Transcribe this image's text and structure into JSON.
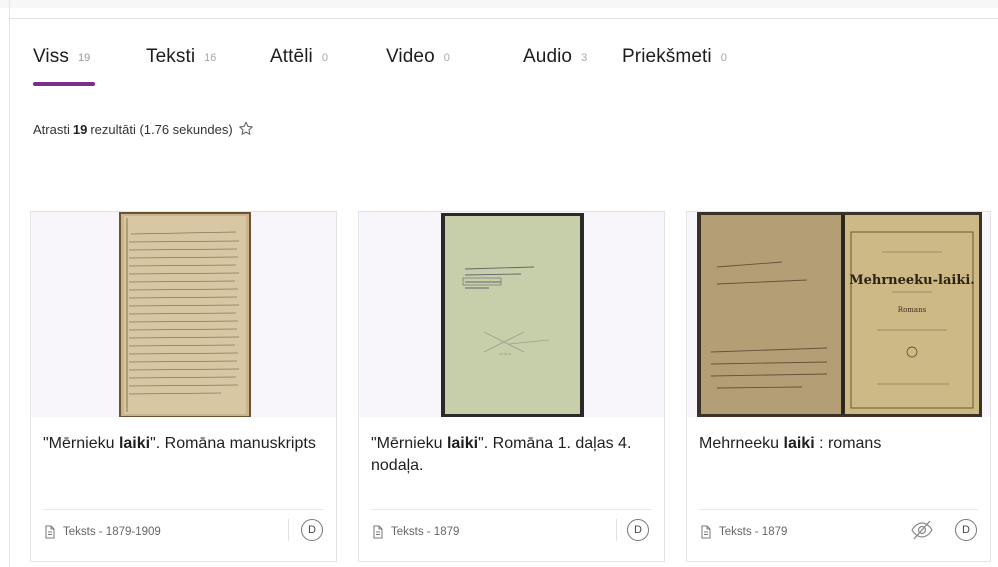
{
  "tabs": [
    {
      "label": "Viss",
      "count": "19",
      "active": true
    },
    {
      "label": "Teksti",
      "count": "16"
    },
    {
      "label": "Attēli",
      "count": "0"
    },
    {
      "label": "Video",
      "count": "0"
    },
    {
      "label": "Audio",
      "count": "3"
    },
    {
      "label": "Priekšmeti",
      "count": "0"
    }
  ],
  "results": {
    "prefix": "Atrasti",
    "count": "19",
    "suffix": "rezultāti (1.76 sekundes)",
    "icon": "star-outline-icon"
  },
  "cards": [
    {
      "title_pre": "\"Mērnieku ",
      "title_bold": "laiki",
      "title_post": "\". Romāna manuskripts",
      "meta": "Teksts - 1879-1909",
      "badge": "D"
    },
    {
      "title_pre": "\"Mērnieku ",
      "title_bold": "laiki",
      "title_post": "\". Romāna 1. daļas 4. nodaļa.",
      "meta": "Teksts - 1879",
      "badge": "D"
    },
    {
      "title_pre": "Mehrneeku ",
      "title_bold": "laiki",
      "title_post": " : romans",
      "meta": "Teksts - 1879",
      "badge": "D",
      "extra_icon": "eye-off-icon",
      "book_title": "Mehrneeku-laiki.",
      "book_subtitle": "Romans"
    }
  ],
  "colors": {
    "accent": "#7b2d8b",
    "thumb_bg": "#f8f6fb"
  }
}
